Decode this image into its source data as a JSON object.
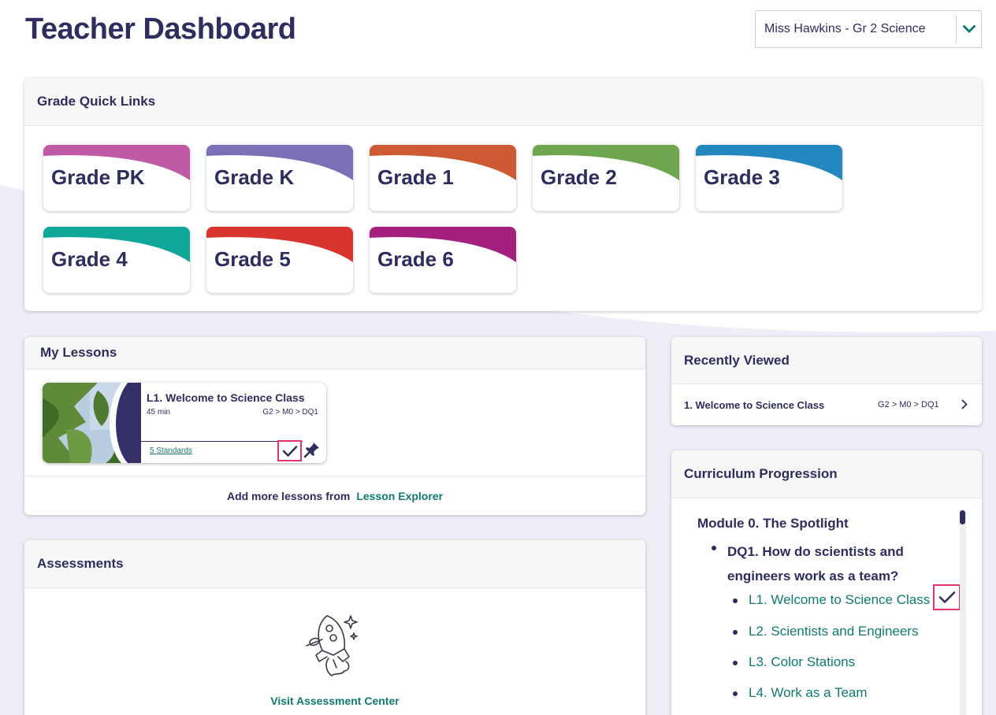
{
  "page": {
    "title": "Teacher Dashboard",
    "class_selector": {
      "value": "Miss Hawkins - Gr 2 Science"
    }
  },
  "grade_quick_links": {
    "header": "Grade Quick Links",
    "grades": [
      {
        "label": "Grade PK",
        "color": "#c15aa6"
      },
      {
        "label": "Grade K",
        "color": "#7b6fb5"
      },
      {
        "label": "Grade 1",
        "color": "#cd5a32"
      },
      {
        "label": "Grade 2",
        "color": "#6da64e"
      },
      {
        "label": "Grade 3",
        "color": "#2587c0"
      },
      {
        "label": "Grade 4",
        "color": "#0fa79a"
      },
      {
        "label": "Grade 5",
        "color": "#d9352f"
      },
      {
        "label": "Grade 6",
        "color": "#a3207f"
      }
    ]
  },
  "my_lessons": {
    "header": "My Lessons",
    "lesson": {
      "title": "L1. Welcome to Science Class",
      "duration": "45 min",
      "path": "G2 > M0 > DQ1",
      "standards": "5 Standards"
    },
    "footer_text": "Add more lessons from",
    "footer_link": "Lesson Explorer"
  },
  "assessments": {
    "header": "Assessments",
    "link": "Visit Assessment Center"
  },
  "recently_viewed": {
    "header": "Recently Viewed",
    "items": [
      {
        "title": "1. Welcome to Science Class",
        "path": "G2 > M0 > DQ1"
      }
    ]
  },
  "curriculum": {
    "header": "Curriculum Progression",
    "module": "Module 0. The Spotlight",
    "dq": "DQ1. How do scientists and engineers work as a team?",
    "lessons": [
      "L1. Welcome to Science Class",
      "L2. Scientists and Engineers",
      "L3. Color Stations",
      "L4. Work as a Team"
    ]
  },
  "colors": {
    "primary_text": "#2f2c5e",
    "link": "#0f7a70",
    "highlight": "#e0336f",
    "background_wave": "#efebf6"
  }
}
